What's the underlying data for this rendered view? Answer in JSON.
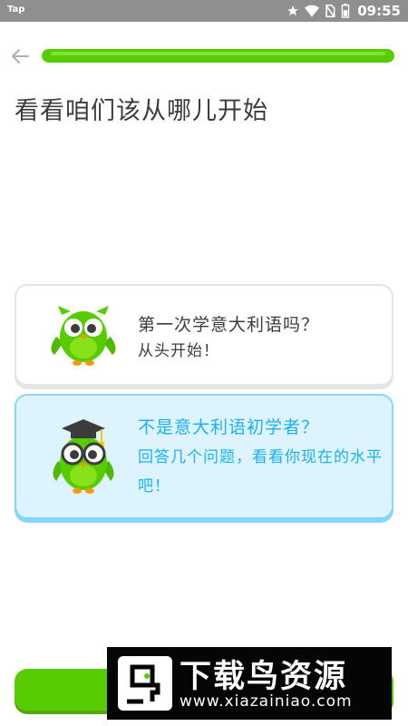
{
  "status_bar": {
    "left_text": "Tap",
    "time": "09:55",
    "icons": [
      "star-icon",
      "wifi-icon",
      "no-sim-icon",
      "battery-icon"
    ]
  },
  "header": {
    "back_icon": "arrow-left-icon",
    "progress": 1.0
  },
  "title": "看看咱们该从哪儿开始",
  "options": [
    {
      "title": "第一次学意大利语吗？",
      "subtitle": "从头开始！",
      "icon": "owl-icon",
      "selected": false
    },
    {
      "title": "不是意大利语初学者？",
      "subtitle": "回答几个问题，看看你现在的水平吧！",
      "icon": "graduate-owl-icon",
      "selected": true
    }
  ],
  "watermark": {
    "title": "下载鸟资源",
    "url": "www.xiazainiao.com"
  },
  "colors": {
    "green": "#58cc02",
    "blue": "#1cb0f6",
    "selected_bg": "#ddf4ff",
    "selected_border": "#84d8ff"
  }
}
